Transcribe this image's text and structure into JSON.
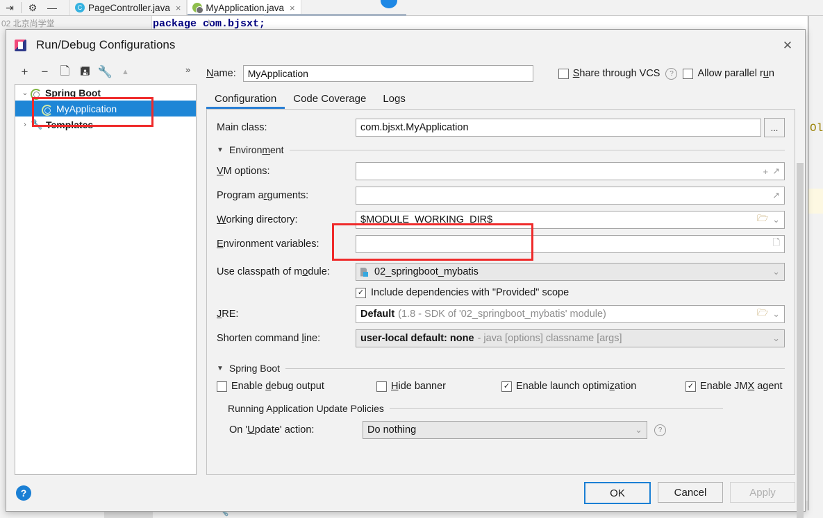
{
  "ide": {
    "toolbar_icons": [
      "collapse-icon",
      "settings-gear-icon",
      "minimize-icon"
    ],
    "tabs": [
      {
        "label": "PageController.java",
        "icon": "class-icon",
        "close": "×",
        "active": false
      },
      {
        "label": "MyApplication.java",
        "icon": "spring-class-icon",
        "close": "×",
        "active": true
      }
    ],
    "project_label": "02  北京尚学堂",
    "code_line": "package com.bjsxt;",
    "right_text": "Ol"
  },
  "dialog": {
    "title": "Run/Debug Configurations",
    "close": "✕",
    "left_toolbar": [
      {
        "name": "add-button",
        "glyph": "+"
      },
      {
        "name": "remove-button",
        "glyph": "−"
      },
      {
        "name": "copy-button",
        "glyph": "⎘"
      },
      {
        "name": "save-button",
        "glyph": "Ὃe"
      },
      {
        "name": "edit-templates-button",
        "glyph": "ὒ7"
      },
      {
        "name": "move-up-button",
        "glyph": "▲"
      }
    ],
    "overflow": "»",
    "tree": [
      {
        "label": "Spring Boot",
        "arrow": "⌄",
        "level": 0,
        "selected": false,
        "icon": "spring-icon"
      },
      {
        "label": "MyApplication",
        "arrow": "",
        "level": 1,
        "selected": true,
        "icon": "spring-icon"
      },
      {
        "label": "Templates",
        "arrow": "›",
        "level": 0,
        "selected": false,
        "icon": "wrench-icon"
      }
    ],
    "name": {
      "label": "Name:",
      "value": "MyApplication"
    },
    "share_vcs": {
      "label": "Share through VCS",
      "checked": false,
      "help": "?"
    },
    "allow_parallel": {
      "label": "Allow parallel run",
      "checked": false
    },
    "tabs": [
      {
        "label": "Configuration",
        "active": true
      },
      {
        "label": "Code Coverage",
        "active": false
      },
      {
        "label": "Logs",
        "active": false
      }
    ],
    "fields": {
      "main_class": {
        "label": "Main class:",
        "value": "com.bjsxt.MyApplication",
        "browse": "..."
      },
      "environment_section": "Environment",
      "vm_options": {
        "label": "VM options:",
        "value": "",
        "icons": [
          "plus-icon",
          "expand-icon"
        ]
      },
      "program_arguments": {
        "label": "Program arguments:",
        "value": "",
        "icons": [
          "expand-icon"
        ]
      },
      "working_directory": {
        "label": "Working directory:",
        "value": "$MODULE_WORKING_DIR$",
        "icons": [
          "folder-icon",
          "chevron-down-icon"
        ]
      },
      "environment_variables": {
        "label": "Environment variables:",
        "value": "",
        "icons": [
          "list-icon"
        ]
      },
      "use_classpath": {
        "label": "Use classpath of module:",
        "value": "02_springboot_mybatis",
        "icons": [
          "chevron-down-icon"
        ]
      },
      "include_provided": {
        "label": "Include dependencies with \"Provided\" scope",
        "checked": true
      },
      "jre": {
        "label": "JRE:",
        "value": "Default",
        "hint": "(1.8 - SDK of '02_springboot_mybatis' module)",
        "icons": [
          "folder-icon",
          "chevron-down-icon"
        ]
      },
      "shorten_cmd": {
        "label": "Shorten command line:",
        "value": "user-local default: none",
        "hint": "- java [options] classname [args]",
        "icons": [
          "chevron-down-icon"
        ]
      },
      "spring_boot_section": "Spring Boot",
      "enable_debug_output": {
        "label": "Enable debug output",
        "checked": false
      },
      "hide_banner": {
        "label": "Hide banner",
        "checked": false
      },
      "enable_launch_optimization": {
        "label": "Enable launch optimization",
        "checked": true
      },
      "enable_jmx_agent": {
        "label": "Enable JMX agent",
        "checked": true
      },
      "update_policies_section": "Running Application Update Policies",
      "on_update_action": {
        "label": "On 'Update' action:",
        "value": "Do nothing",
        "help": "?"
      }
    },
    "footer": {
      "help": "?",
      "ok": "OK",
      "cancel": "Cancel",
      "apply": "Apply"
    }
  },
  "colors": {
    "selection_blue": "#1e86d6",
    "annotation_red": "#ef2b2b",
    "accent_blue": "#1a7fd4"
  }
}
